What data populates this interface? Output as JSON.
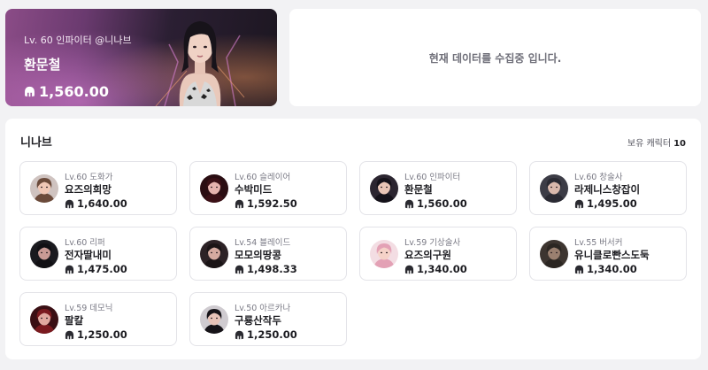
{
  "hero": {
    "level_line": "Lv. 60 인파이터 @니나브",
    "name": "환문철",
    "power": "1,560.00"
  },
  "notice": "현재 데이터를 수집중 입니다.",
  "roster": {
    "title": "니나브",
    "count_label": "보유 캐릭터",
    "count": "10",
    "characters": [
      {
        "level": "Lv.60 도화가",
        "name": "요즈의희망",
        "power": "1,640.00",
        "avatar": "painter-avatar",
        "skin": "#f0c7b5",
        "hair": "#6b4a3a",
        "bg": "#cfc3c0"
      },
      {
        "level": "Lv.60 슬레이어",
        "name": "수박미드",
        "power": "1,592.50",
        "avatar": "slayer-avatar",
        "skin": "#e6b3ae",
        "hair": "#3a1016",
        "bg": "#2a0d12"
      },
      {
        "level": "Lv.60 인파이터",
        "name": "환문철",
        "power": "1,560.00",
        "avatar": "infighter-avatar",
        "skin": "#e9c5b6",
        "hair": "#15121a",
        "bg": "#2b2530"
      },
      {
        "level": "Lv.60 창술사",
        "name": "라제니스창잡이",
        "power": "1,495.00",
        "avatar": "lancemaster-avatar",
        "skin": "#d9b8ac",
        "hair": "#2a2a33",
        "bg": "#3c3c46"
      },
      {
        "level": "Lv.60 리퍼",
        "name": "전자딸내미",
        "power": "1,475.00",
        "avatar": "reaper-avatar",
        "skin": "#c99a95",
        "hair": "#111014",
        "bg": "#1a1a1f"
      },
      {
        "level": "Lv.54 블레이드",
        "name": "모모의땅콩",
        "power": "1,498.33",
        "avatar": "blade-avatar",
        "skin": "#d4aaa0",
        "hair": "#1a1416",
        "bg": "#2c2226"
      },
      {
        "level": "Lv.59 기상술사",
        "name": "요즈의구원",
        "power": "1,340.00",
        "avatar": "aeromancer-avatar",
        "skin": "#f5d2c8",
        "hair": "#e3a1b5",
        "bg": "#f3dde3"
      },
      {
        "level": "Lv.55 버서커",
        "name": "유니클로빤스도둑",
        "power": "1,340.00",
        "avatar": "berserker-avatar",
        "skin": "#9b8070",
        "hair": "#2b2622",
        "bg": "#3d3530"
      },
      {
        "level": "Lv.59 데모닉",
        "name": "팔칼",
        "power": "1,250.00",
        "avatar": "demonic-avatar",
        "skin": "#e1a9a0",
        "hair": "#7a1a1f",
        "bg": "#3a0f14"
      },
      {
        "level": "Lv.50 아르카나",
        "name": "구룡산작두",
        "power": "1,250.00",
        "avatar": "arcana-avatar",
        "skin": "#e7c3b8",
        "hair": "#161318",
        "bg": "#cfcbd0"
      }
    ]
  }
}
